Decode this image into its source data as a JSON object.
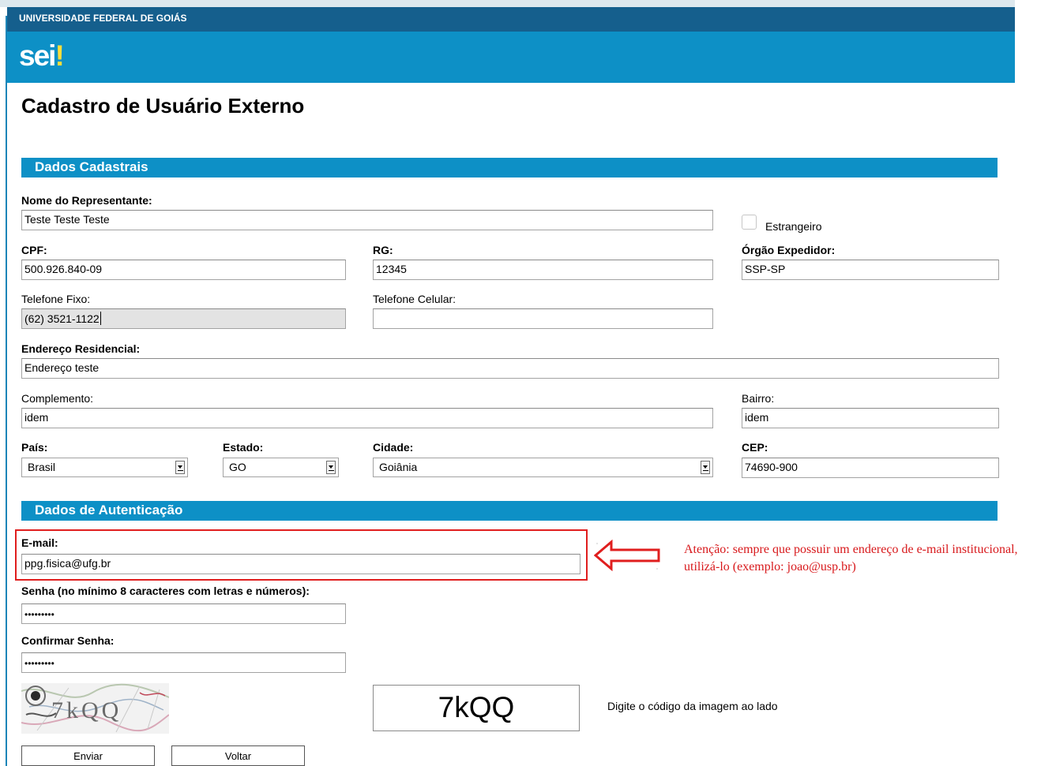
{
  "header": {
    "org": "UNIVERSIDADE FEDERAL DE GOIÁS",
    "logo_text": "sei",
    "logo_bang": "!",
    "brand_color": "#0d90c6"
  },
  "page_title": "Cadastro de Usuário Externo",
  "sections": {
    "registration": "Dados Cadastrais",
    "authentication": "Dados de Autenticação"
  },
  "form": {
    "nome": {
      "label": "Nome do Representante:",
      "value": "Teste Teste Teste"
    },
    "estrangeiro": {
      "label": "Estrangeiro",
      "checked": false
    },
    "cpf": {
      "label": "CPF:",
      "value": "500.926.840-09"
    },
    "rg": {
      "label": "RG:",
      "value": "12345"
    },
    "orgao": {
      "label": "Órgão Expedidor:",
      "value": "SSP-SP"
    },
    "telefone_fixo": {
      "label": "Telefone Fixo:",
      "value": "(62) 3521-1122"
    },
    "telefone_celular": {
      "label": "Telefone Celular:",
      "value": ""
    },
    "endereco": {
      "label": "Endereço Residencial:",
      "value": "Endereço teste"
    },
    "complemento": {
      "label": "Complemento:",
      "value": "idem"
    },
    "bairro": {
      "label": "Bairro:",
      "value": "idem"
    },
    "pais": {
      "label": "País:",
      "value": "Brasil"
    },
    "estado": {
      "label": "Estado:",
      "value": "GO"
    },
    "cidade": {
      "label": "Cidade:",
      "value": "Goiânia"
    },
    "cep": {
      "label": "CEP:",
      "value": "74690-900"
    },
    "email": {
      "label": "E-mail:",
      "value": "ppg.fisica@ufg.br"
    },
    "senha": {
      "label": "Senha (no mínimo 8 caracteres com letras e números):",
      "value": "•••••••••"
    },
    "confirmar_senha": {
      "label": "Confirmar Senha:",
      "value": "•••••••••"
    },
    "captcha": {
      "image_text": "7kQQ",
      "input_value": "7kQQ",
      "hint": "Digite o código da imagem ao lado"
    }
  },
  "annotation": {
    "text": "Atenção: sempre que possuir um endereço de e-mail institucional, utilizá-lo (exemplo: joao@usp.br)",
    "color": "#d8191c"
  },
  "buttons": {
    "submit": "Enviar",
    "back": "Voltar"
  }
}
